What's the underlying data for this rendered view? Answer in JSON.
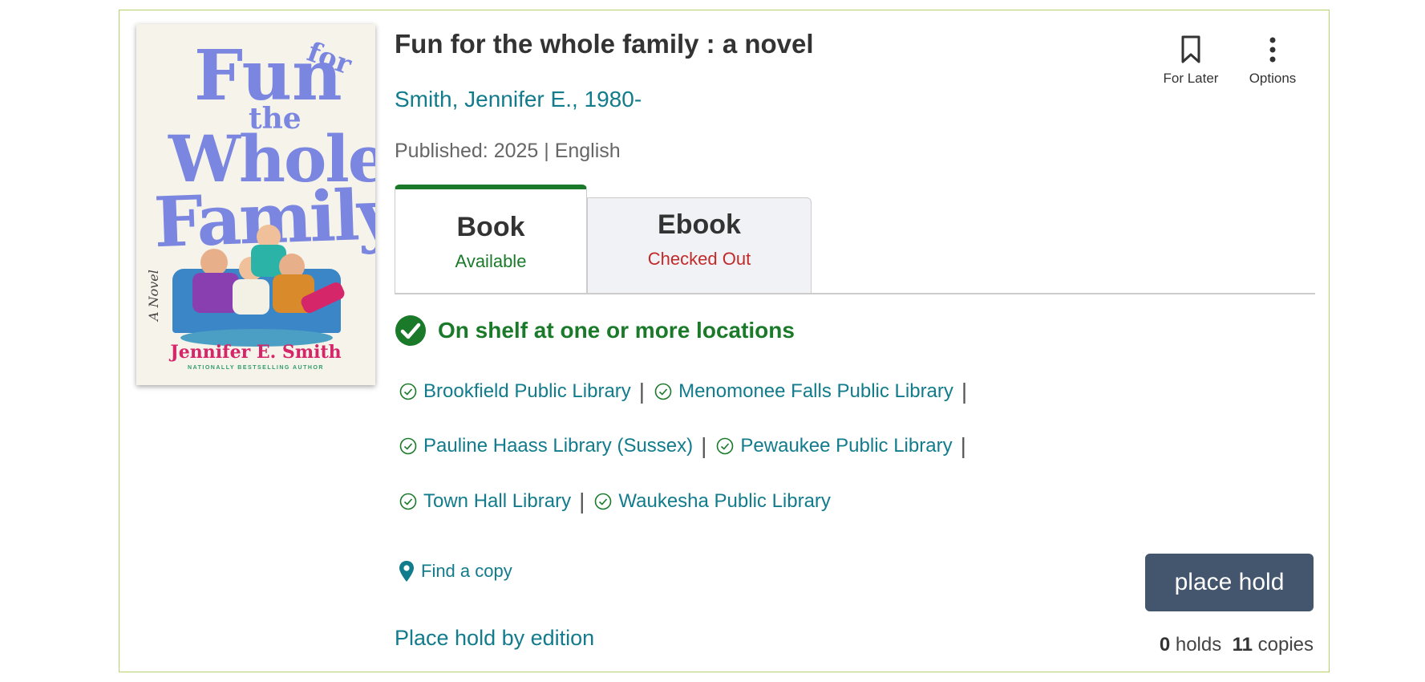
{
  "book": {
    "title": "Fun for the whole family : a novel",
    "author": "Smith, Jennifer E., 1980-",
    "published": "Published: 2025 | English"
  },
  "cover": {
    "title_words": [
      "Fun",
      "for",
      "the",
      "Whole",
      "Family"
    ],
    "subtitle": "A Novel",
    "author": "Jennifer E. Smith",
    "tagline": "NATIONALLY BESTSELLING AUTHOR"
  },
  "actions": {
    "for_later": "For Later",
    "options": "Options"
  },
  "tabs": [
    {
      "name": "Book",
      "status": "Available",
      "status_color": "#1a7a2a"
    },
    {
      "name": "Ebook",
      "status": "Checked Out",
      "status_color": "#c22a2a"
    }
  ],
  "availability": {
    "message": "On shelf at one or more locations",
    "locations": [
      "Brookfield Public Library",
      "Menomonee Falls Public Library",
      "Pauline Haass Library (Sussex)",
      "Pewaukee Public Library",
      "Town Hall Library",
      "Waukesha Public Library"
    ]
  },
  "links": {
    "find_copy": "Find a copy",
    "by_edition": "Place hold by edition"
  },
  "hold": {
    "button": "place hold",
    "holds_count": "0",
    "holds_label": "holds",
    "copies_count": "11",
    "copies_label": "copies"
  },
  "colors": {
    "accent_link": "#127b8c",
    "available_green": "#1a7a2a",
    "checked_out_red": "#c22a2a",
    "button_bg": "#44566e",
    "card_border": "#b5d36b"
  },
  "icons": {
    "for_later": "bookmark-icon",
    "options": "vertical-dots-icon",
    "shelf": "check-circle-icon",
    "location": "check-circle-outline-icon",
    "find": "map-pin-icon"
  }
}
